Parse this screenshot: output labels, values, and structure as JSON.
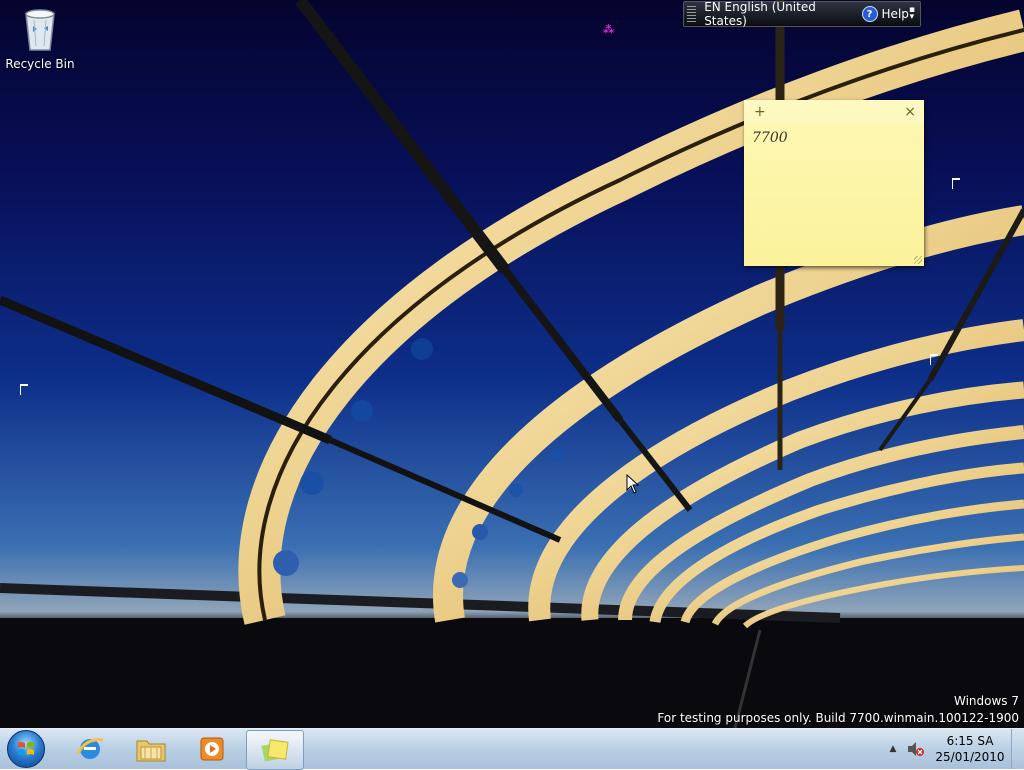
{
  "desktop": {
    "icons": [
      {
        "label": "Recycle Bin",
        "icon": "recycle-bin-icon"
      }
    ],
    "watermark": {
      "line1": "Windows 7",
      "line2": "For testing purposes only. Build 7700.winmain.100122-1900"
    }
  },
  "language_bar": {
    "language": "EN English (United States)",
    "help_label": "Help",
    "help_icon": "?"
  },
  "sticky_note": {
    "add_glyph": "+",
    "close_glyph": "×",
    "text": "7700",
    "color": "#fcf29b"
  },
  "taskbar": {
    "start_icon": "windows-logo-icon",
    "pinned": [
      {
        "icon": "internet-explorer-icon"
      },
      {
        "icon": "windows-explorer-icon"
      },
      {
        "icon": "media-player-icon"
      },
      {
        "icon": "sticky-notes-icon",
        "active": true
      }
    ],
    "tray": {
      "show_hidden_glyph": "▲",
      "volume_icon": "volume-muted-icon",
      "time": "6:15 SA",
      "date": "25/01/2010"
    }
  },
  "colors": {
    "sky_top": "#04042e",
    "sky_horizon": "#3a6fb2",
    "bridge_lit": "#f6e7a8",
    "taskbar": "#b9cfe4"
  }
}
